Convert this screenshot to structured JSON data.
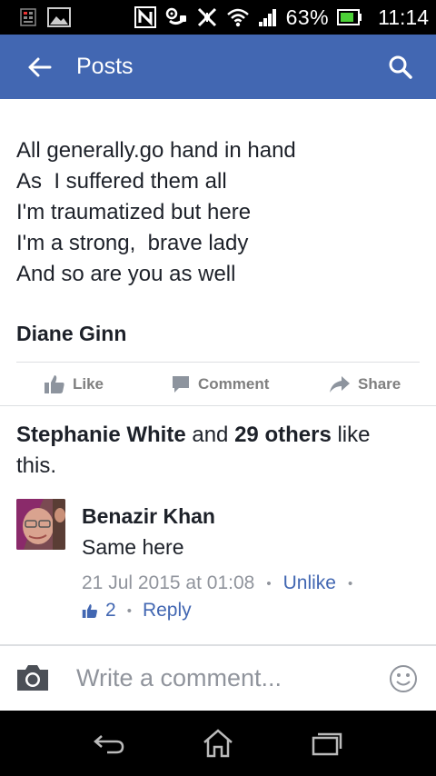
{
  "status_bar": {
    "battery_text": "63%",
    "time": "11:14",
    "icons": [
      "sim-icon",
      "image-icon",
      "nfc-icon",
      "voicemail-icon",
      "silent-icon",
      "wifi-icon",
      "signal-icon",
      "battery-icon"
    ]
  },
  "app_bar": {
    "title": "Posts",
    "back_icon": "arrow-left-icon",
    "search_icon": "search-icon",
    "color": "#4267b2"
  },
  "post": {
    "lines": [
      "All generally.go hand in hand",
      "As  I suffered them all",
      "I'm traumatized but here",
      "I'm a strong,  brave lady",
      "And so are you as well"
    ],
    "author": "Diane Ginn"
  },
  "actions": {
    "like": "Like",
    "comment": "Comment",
    "share": "Share"
  },
  "likes": {
    "name": "Stephanie White",
    "and": "and",
    "others": "29 others",
    "suffix": "like",
    "line2": "this."
  },
  "comment": {
    "author": "Benazir Khan",
    "text": "Same here",
    "timestamp": "21 Jul 2015 at 01:08",
    "unlike": "Unlike",
    "like_count": "2",
    "reply": "Reply"
  },
  "composer": {
    "placeholder": "Write a comment..."
  },
  "colors": {
    "accent": "#4267b2",
    "muted": "#90949c",
    "text": "#1d2129"
  }
}
